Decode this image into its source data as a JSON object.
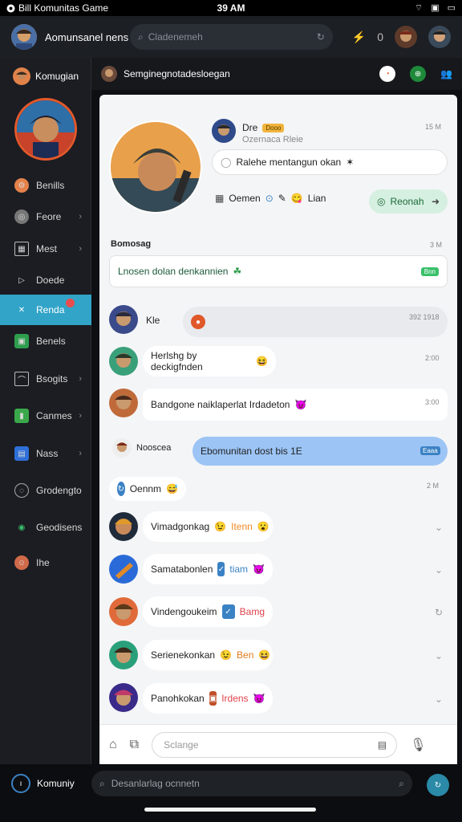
{
  "status_bar": {
    "app_label": "Bill Komunitas Game",
    "time": "39 AM"
  },
  "header": {
    "title": "Aomunsanel nens",
    "search_placeholder": "Cladenemeh",
    "icon_count": "0"
  },
  "sidebar": {
    "user_name": "Komugian",
    "items": [
      {
        "label": "Benills",
        "icon": "settings-icon"
      },
      {
        "label": "Feore",
        "icon": "compass-icon",
        "chevron": true
      },
      {
        "label": "Mest",
        "icon": "grid-icon",
        "chevron": true
      },
      {
        "label": "Doede",
        "icon": "play-icon"
      },
      {
        "label": "Renda",
        "icon": "star-icon",
        "active": true
      },
      {
        "label": "Benels",
        "icon": "chat-icon"
      },
      {
        "label": "Bsogits",
        "icon": "chart-icon",
        "chevron": true
      },
      {
        "label": "Canmes",
        "icon": "game-icon",
        "chevron": true
      },
      {
        "label": "Nass",
        "icon": "book-icon",
        "chevron": true
      },
      {
        "label": "Grodengto",
        "icon": "globe-icon"
      },
      {
        "label": "Geodisens",
        "icon": "pin-icon"
      },
      {
        "label": "Ihe",
        "icon": "group-icon"
      }
    ],
    "bottom_user": "Komuniy"
  },
  "channel": {
    "title": "Semginegnotadesloegan"
  },
  "post": {
    "author": "Dre",
    "badge": "Dooo",
    "subtitle": "Ozernaca Rleie",
    "time": "15 M",
    "text": "Ralehe mentangun okan",
    "reaction_label": "Oemen",
    "reaction_label_2": "Lian",
    "reply_button": "Reonah"
  },
  "section": {
    "title": "Bomosag",
    "time": "3 M"
  },
  "pinned": {
    "text": "Lnosen dolan denkannien",
    "tag": "Bnn"
  },
  "messages": [
    {
      "name": "Kle",
      "time": "392 1918"
    },
    {
      "text": "Herlshg by deckigfnden",
      "time": "2:00"
    },
    {
      "text": "Bandgone naiklaperlat Irdadeton",
      "time": "3:00"
    },
    {
      "name": "Nooscea",
      "text": "Ebomunitan dost bis 1E",
      "time": "Eaaa"
    }
  ],
  "group": {
    "name": "Oennm",
    "time": "2 M",
    "items": [
      {
        "name": "Vimadgonkag",
        "tag": "Itenn",
        "tag_color": "#f08a24"
      },
      {
        "name": "Samatabonlen",
        "tag": "tiam",
        "tag_color": "#3b82c4"
      },
      {
        "name": "Vindengoukeim",
        "tag": "Bamg",
        "tag_color": "#e0424a"
      },
      {
        "name": "Serienekonkan",
        "tag": "Ben",
        "tag_color": "#e07a1a"
      },
      {
        "name": "Panohkokan",
        "tag": "Irdens",
        "tag_color": "#e0424a"
      }
    ]
  },
  "input": {
    "placeholder": "Sclange"
  },
  "bottom_search": {
    "placeholder": "Desanlarlag ocnnetn"
  },
  "colors": {
    "accent": "#32a4c8",
    "active_message": "#9cc4f5",
    "reply_green": "#d5efe0"
  }
}
